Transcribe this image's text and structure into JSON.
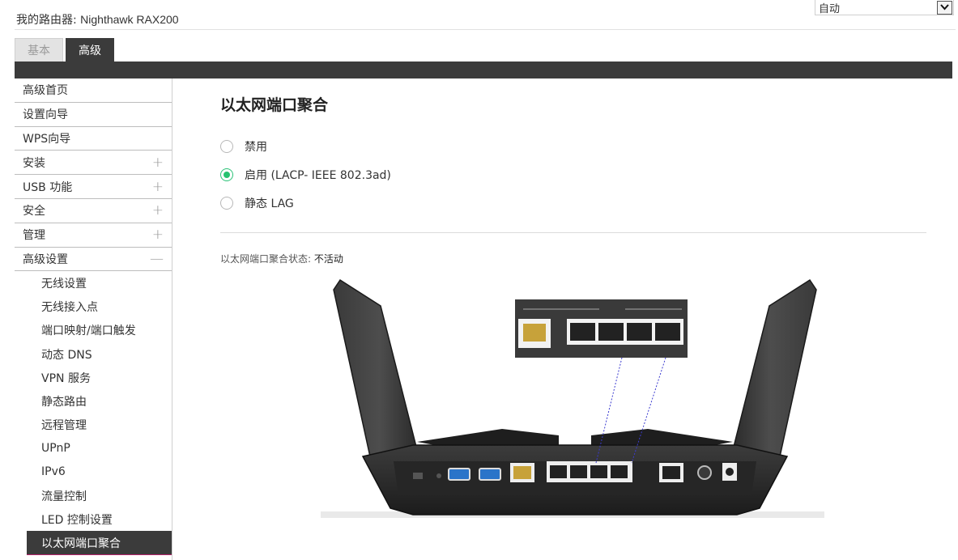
{
  "header": {
    "router_label": "我的路由器:",
    "router_model": "Nighthawk RAX200",
    "language": "自动"
  },
  "tabs": [
    {
      "label": "基本",
      "active": false
    },
    {
      "label": "高级",
      "active": true
    }
  ],
  "sidebar": {
    "items": [
      {
        "label": "高级首页",
        "expandable": false
      },
      {
        "label": "设置向导",
        "expandable": false
      },
      {
        "label": "WPS向导",
        "expandable": false
      },
      {
        "label": "安装",
        "expandable": true,
        "toggle": "+"
      },
      {
        "label": "USB 功能",
        "expandable": true,
        "toggle": "+"
      },
      {
        "label": "安全",
        "expandable": true,
        "toggle": "+"
      },
      {
        "label": "管理",
        "expandable": true,
        "toggle": "+"
      },
      {
        "label": "高级设置",
        "expandable": true,
        "toggle": "—"
      }
    ],
    "subitems": [
      {
        "label": "无线设置"
      },
      {
        "label": "无线接入点"
      },
      {
        "label": "端口映射/端口触发"
      },
      {
        "label": "动态 DNS"
      },
      {
        "label": "VPN 服务"
      },
      {
        "label": "静态路由"
      },
      {
        "label": "远程管理"
      },
      {
        "label": "UPnP"
      },
      {
        "label": "IPv6"
      },
      {
        "label": "流量控制"
      },
      {
        "label": "LED 控制设置"
      },
      {
        "label": "以太网端口聚合",
        "active": true
      }
    ]
  },
  "main": {
    "title": "以太网端口聚合",
    "options": [
      {
        "label": "禁用",
        "selected": false
      },
      {
        "label": "启用 (LACP- IEEE 802.3ad)",
        "selected": true
      },
      {
        "label": "静态 LAG",
        "selected": false
      }
    ],
    "status_label": "以太网端口聚合状态:",
    "status_value": "不活动"
  },
  "colors": {
    "dark": "#3b3b3b",
    "radio_selected": "#27c270",
    "active_underline": "#b6236b"
  }
}
